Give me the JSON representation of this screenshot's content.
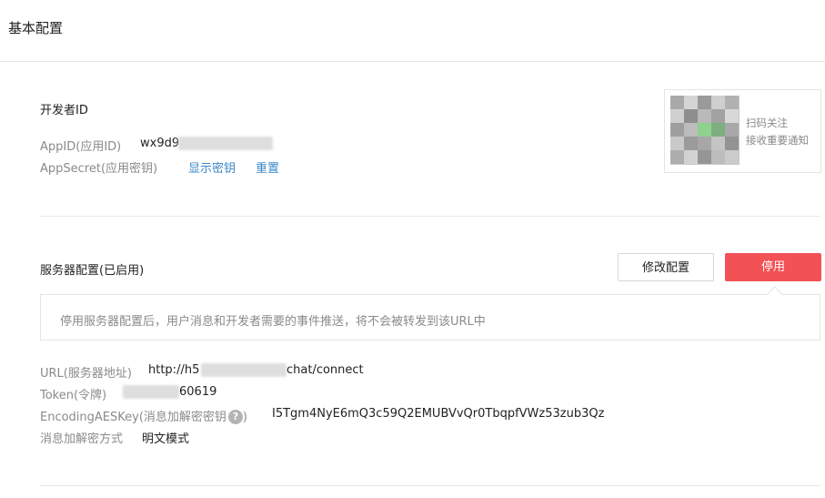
{
  "page": {
    "title": "基本配置"
  },
  "developer": {
    "section_title": "开发者ID",
    "appid_label": "AppID(应用ID)",
    "appid_value": "wx9d9",
    "appsecret_label": "AppSecret(应用密钥)",
    "show_secret_link": "显示密钥",
    "reset_link": "重置"
  },
  "qr": {
    "line1": "扫码关注",
    "line2": "接收重要通知"
  },
  "server": {
    "section_title": "服务器配置(已启用)",
    "modify_button": "修改配置",
    "stop_button": "停用",
    "tip": "停用服务器配置后，用户消息和开发者需要的事件推送，将不会被转发到该URL中",
    "url_label": "URL(服务器地址)",
    "url_prefix": "http://h5",
    "url_suffix": "chat/connect",
    "token_label": "Token(令牌)",
    "token_suffix": "60619",
    "aes_label": "EncodingAESKey(消息加解密密钥",
    "aes_help_icon": "help-icon",
    "aes_label_close": ")",
    "aes_value": "I5Tgm4NyE6mQ3c59Q2EMUBVvQr0TbqpfVWz53zub3Qz",
    "mode_label": "消息加解密方式",
    "mode_value": "明文模式"
  },
  "colors": {
    "link": "#3b88c7",
    "danger": "#f25155",
    "divider": "#e6e6e6"
  }
}
